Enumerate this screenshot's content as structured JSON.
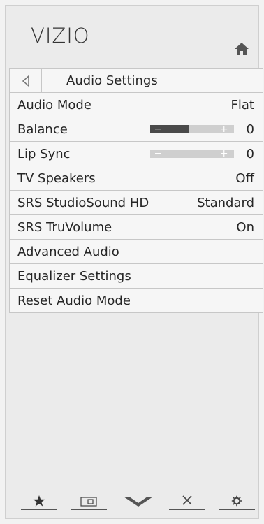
{
  "logo": "VIZIO",
  "header": {
    "title": "Audio Settings"
  },
  "menu": [
    {
      "label": "Audio Mode",
      "value": "Flat"
    },
    {
      "label": "Balance",
      "value": "0",
      "slider": {
        "level": 0.47
      }
    },
    {
      "label": "Lip Sync",
      "value": "0",
      "slider": {
        "level": 0.0
      }
    },
    {
      "label": "TV Speakers",
      "value": "Off"
    },
    {
      "label": "SRS StudioSound HD",
      "value": "Standard"
    },
    {
      "label": "SRS TruVolume",
      "value": "On"
    },
    {
      "label": "Advanced Audio",
      "value": ""
    },
    {
      "label": "Equalizer Settings",
      "value": ""
    },
    {
      "label": "Reset Audio Mode",
      "value": ""
    }
  ],
  "icons": {
    "home": "home-icon",
    "back": "back-icon",
    "star": "star-icon",
    "widget": "widget-icon",
    "chevron": "v-chevron-icon",
    "close": "close-icon",
    "settings": "gear-icon"
  },
  "colors": {
    "panel": "#ebebeb",
    "slider_fill": "#4a4a4a",
    "slider_track": "#cfcfcf"
  }
}
